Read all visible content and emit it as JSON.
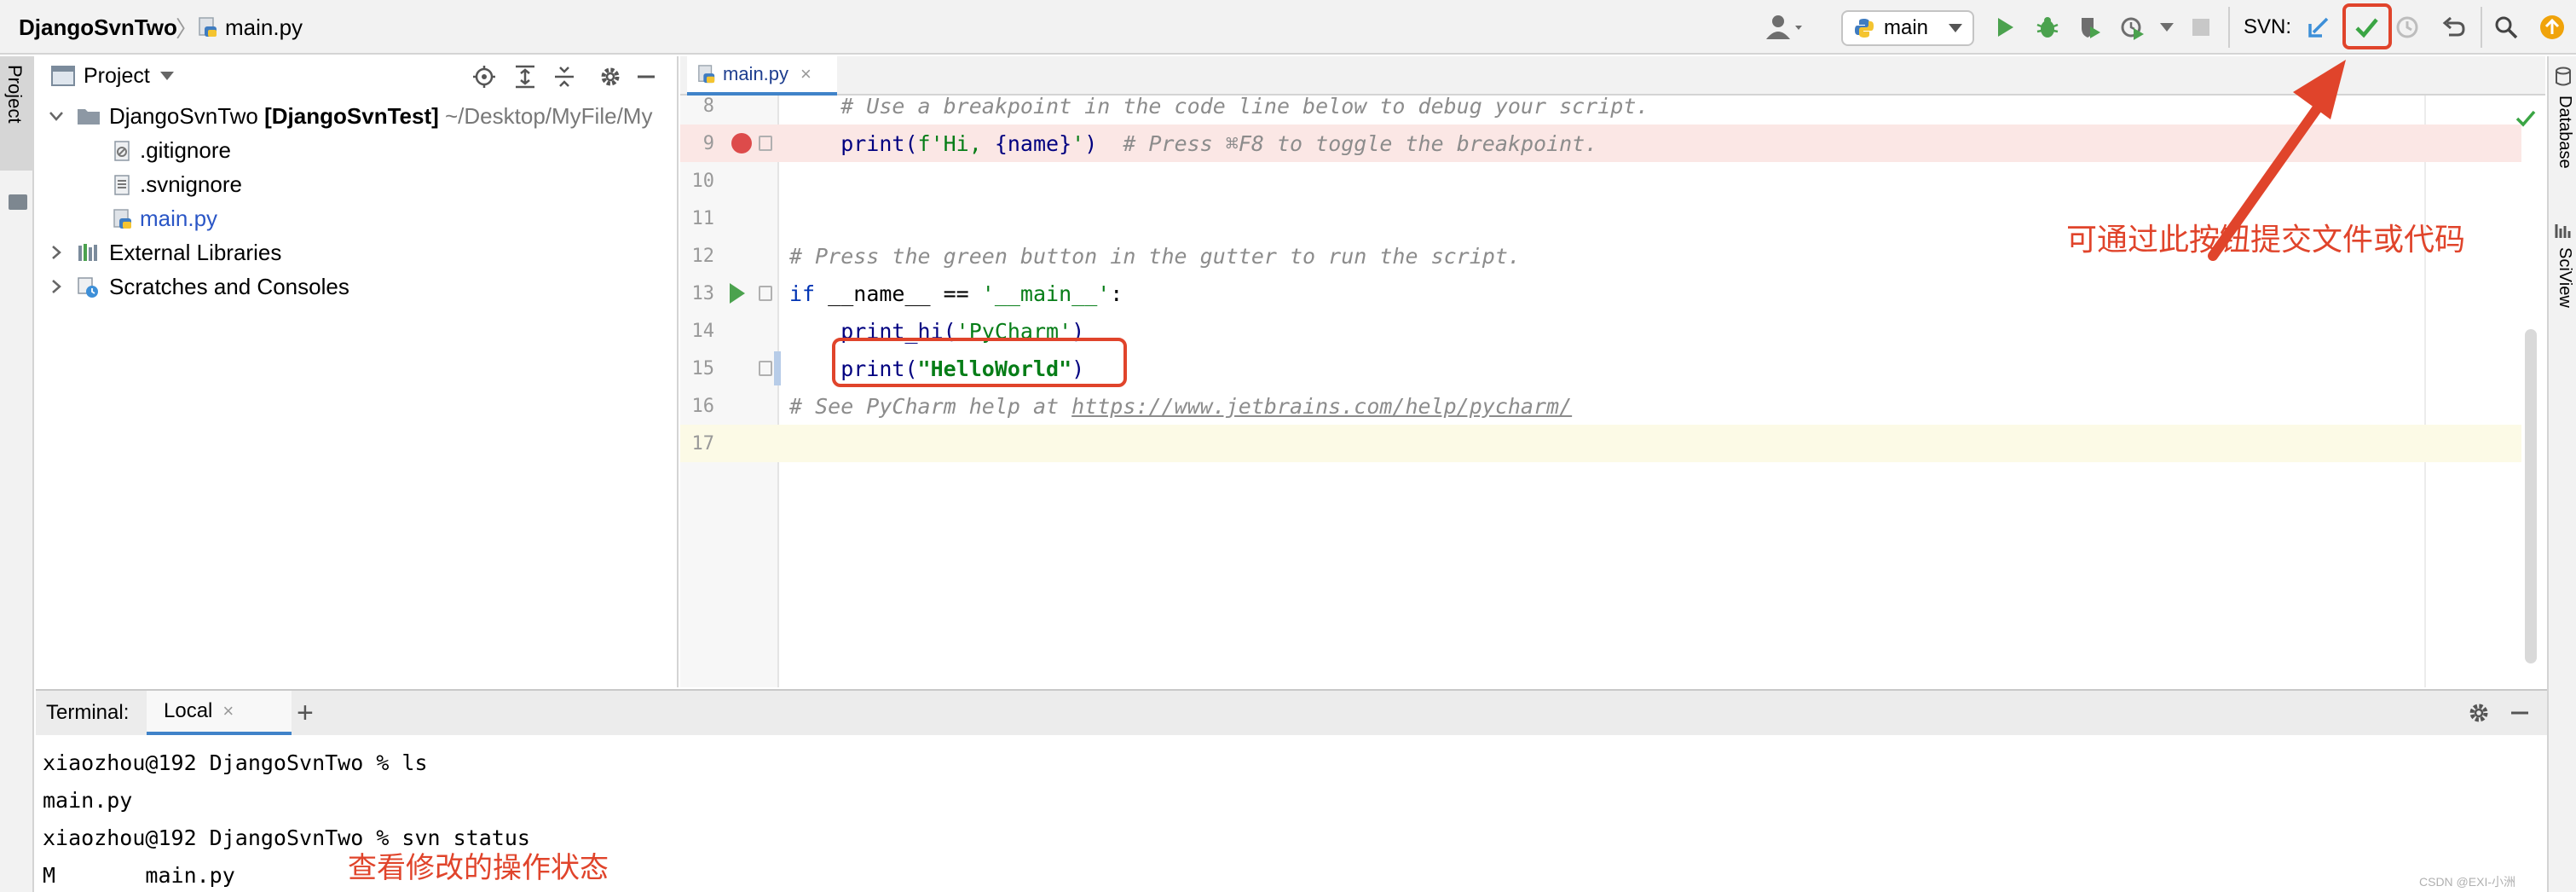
{
  "toolbar": {
    "project_name": "DjangoSvnTwo",
    "breadcrumb_sep": "〉",
    "file_name": "main.py",
    "branch": "main",
    "svn_label": "SVN:",
    "colors": {
      "run": "#4ba24e",
      "update": "#3d8fd8",
      "commit": "#3aa544",
      "notify": "#f0a30a",
      "annotation": "#e0442b"
    }
  },
  "left_strip": {
    "project_tab": "Project"
  },
  "project_panel": {
    "title": "Project",
    "tree": {
      "root_name": "DjangoSvnTwo",
      "root_module": "[DjangoSvnTest]",
      "root_path": "~/Desktop/MyFile/My",
      "files": [
        ".gitignore",
        ".svnignore",
        "main.py"
      ],
      "external": "External Libraries",
      "scratches": "Scratches and Consoles"
    }
  },
  "editor": {
    "tab": "main.py",
    "lines": [
      {
        "num": "8"
      },
      {
        "num": "9"
      },
      {
        "num": "10"
      },
      {
        "num": "11"
      },
      {
        "num": "12"
      },
      {
        "num": "13"
      },
      {
        "num": "14"
      },
      {
        "num": "15"
      },
      {
        "num": "16"
      },
      {
        "num": "17"
      }
    ],
    "code": {
      "l8_comment": "    # Use a breakpoint in the code line below to debug your script.",
      "l9_fn": "    print(",
      "l9_str1": "f'Hi, ",
      "l9_var": "{name}",
      "l9_str2": "'",
      "l9_close": ")",
      "l9_comment": "  # Press ⌘F8 to toggle the breakpoint.",
      "l12_comment": "# Press the green button in the gutter to run the script.",
      "l13_kw": "if",
      "l13_rest": " __name__ == ",
      "l13_str": "'__main__'",
      "l13_colon": ":",
      "l14_fn": "    print_hi(",
      "l14_str": "'PyCharm'",
      "l14_close": ")",
      "l15_fn": "    print(",
      "l15_str": "\"HelloWorld\"",
      "l15_close": ")",
      "l16_comment": "# See PyCharm help at ",
      "l16_url": "https://www.jetbrains.com/help/pycharm/"
    },
    "annotation": "可通过此按钮提交文件或代码"
  },
  "right_strip": {
    "tabs": [
      "Database",
      "SciView"
    ]
  },
  "terminal": {
    "label": "Terminal:",
    "tab": "Local",
    "add": "+",
    "lines": [
      "xiaozhou@192 DjangoSvnTwo % ls",
      "main.py",
      "xiaozhou@192 DjangoSvnTwo % svn status",
      "M       main.py"
    ],
    "annotation": "查看修改的操作状态",
    "watermark": "CSDN @EXI-小洲"
  }
}
